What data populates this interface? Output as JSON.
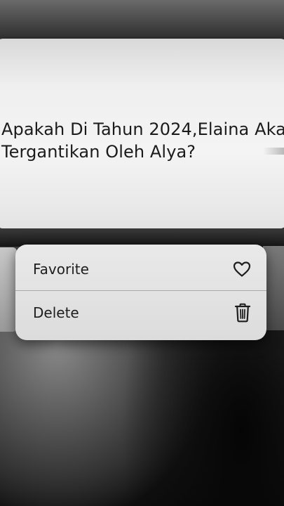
{
  "message": {
    "line1": "Apakah Di Tahun 2024,Elaina Aka",
    "line2": "Tergantikan Oleh Alya?"
  },
  "context_menu": {
    "items": [
      {
        "label": "Favorite",
        "icon": "heart-icon"
      },
      {
        "label": "Delete",
        "icon": "trash-icon"
      }
    ]
  },
  "colors": {
    "card": "#f0f0f0",
    "menu": "#e4e4e4",
    "text": "#1b1b1b"
  }
}
